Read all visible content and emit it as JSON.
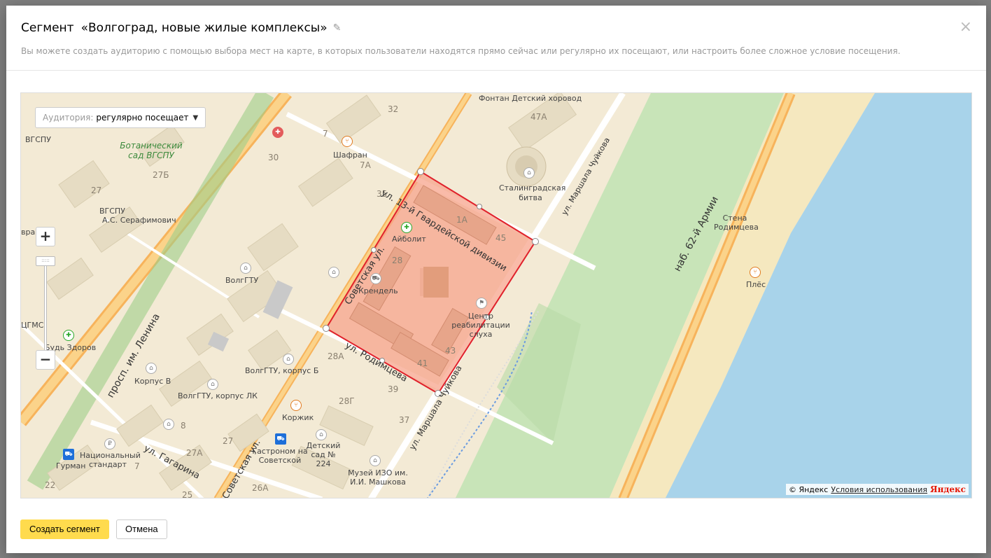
{
  "modal": {
    "segment_word": "Сегмент",
    "segment_name": "«Волгоград, новые жилые комплексы»",
    "subtitle": "Вы можете создать аудиторию с помощью выбора мест на карте, в которых пользователи находятся прямо сейчас или регулярно их посещают, или настроить более сложное условие посещения.",
    "close_icon": "×"
  },
  "map": {
    "audience_label": "Аудитория:",
    "audience_value": "регулярно посещает",
    "zoom_in": "+",
    "zoom_out": "−",
    "copyright": "© Яндекс",
    "terms": "Условия использования",
    "logo": "Яндекс",
    "labels": {
      "fountain": "Фонтан Детский хоровод",
      "h47a": "47А",
      "h32": "32",
      "h7": "7",
      "shafran": "Шафран",
      "h7a": "7А",
      "h30": "30",
      "h35": "35",
      "botanic": "Ботанический сад ВГСПУ",
      "vgspu_top": "ВГСПУ",
      "h27b": "27Б",
      "h27": "27",
      "vgspu": "ВГСПУ",
      "serafimovich": "А.С. Серафимович",
      "stalingrad": "Сталинградская битва",
      "gvardia": "ул. 13-й Гвардейской дивизии",
      "chuikova_top": "ул. Маршала Чуйкова",
      "h1a": "1А",
      "h45": "45",
      "aibolit": "Айболит",
      "h28": "28",
      "krendel": "Крендель",
      "sovetskaya": "Советская ул.",
      "volggtu": "ВолгГТУ",
      "center": "Центр реабилитации слуха",
      "h43": "43",
      "h41": "41",
      "rodimtseva": "ул. Родимцева",
      "h28a": "28А",
      "volggtu_b": "ВолгГТУ, корпус Б",
      "korpus_v": "Корпус В",
      "volggtu_lk": "ВолгГТУ, корпус ЛК",
      "h39": "39",
      "h28g": "28Г",
      "korzhik": "Коржик",
      "chuikova_bottom": "ул. Маршала Чуйкова",
      "h37": "37",
      "h8": "8",
      "h27_2": "27",
      "h27a": "27А",
      "gastronom": "Гастроном на Советской",
      "detsad": "Детский сад № 224",
      "nac_standart": "Национальный стандарт",
      "gurman": "Гурман",
      "h7_2": "7",
      "gagarina": "ул. Гагарина",
      "sovetskaya2": "Советская ул.",
      "muzei": "Музей ИЗО им. И.И. Машкова",
      "h26a": "26А",
      "h22": "22",
      "h25": "25",
      "lenina": "просп. им. Ленина",
      "bud_zdorov": "Будь Здоров",
      "tsgms": "ЦГМС",
      "nab": "наб. 62-й Армии",
      "stena": "Стена Родимцева",
      "ples": "Плёс",
      "vrach": "врач"
    }
  },
  "footer": {
    "create_label": "Создать сегмент",
    "cancel_label": "Отмена"
  },
  "colors": {
    "polygon_fill": "#f7a48c",
    "polygon_stroke": "#e0212b",
    "water": "#a8d3ea",
    "park": "#c6e3b6",
    "road_major": "#f7b35b",
    "button_primary": "#ffdb4d"
  }
}
